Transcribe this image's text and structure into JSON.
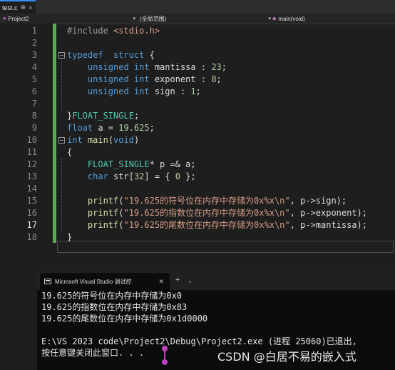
{
  "editor": {
    "tab": {
      "name": "test.c",
      "pin": "⊕",
      "close": "×"
    },
    "nav": {
      "project": "Project2",
      "scope": "(全局范围)",
      "function": "main(void)"
    },
    "line_numbers": [
      "1",
      "2",
      "3",
      "4",
      "5",
      "6",
      "7",
      "8",
      "9",
      "10",
      "11",
      "12",
      "13",
      "14",
      "15",
      "16",
      "17",
      "18"
    ],
    "lines": [
      [
        {
          "t": "#include ",
          "c": "pp"
        },
        {
          "t": "<stdio.h>",
          "c": "str"
        }
      ],
      [],
      [
        {
          "t": "typedef  ",
          "c": "kw"
        },
        {
          "t": "struct ",
          "c": "kw"
        },
        {
          "t": "{",
          "c": "id"
        }
      ],
      [
        {
          "t": "    unsigned ",
          "c": "kw"
        },
        {
          "t": "int ",
          "c": "kw"
        },
        {
          "t": "mantissa : ",
          "c": "id"
        },
        {
          "t": "23",
          "c": "num"
        },
        {
          "t": ";",
          "c": "id"
        }
      ],
      [
        {
          "t": "    unsigned ",
          "c": "kw"
        },
        {
          "t": "int ",
          "c": "kw"
        },
        {
          "t": "exponent : ",
          "c": "id"
        },
        {
          "t": "8",
          "c": "num"
        },
        {
          "t": ";",
          "c": "id"
        }
      ],
      [
        {
          "t": "    unsigned ",
          "c": "kw"
        },
        {
          "t": "int ",
          "c": "kw"
        },
        {
          "t": "sign : ",
          "c": "id"
        },
        {
          "t": "1",
          "c": "num"
        },
        {
          "t": ";",
          "c": "id"
        }
      ],
      [],
      [
        {
          "t": "}",
          "c": "id"
        },
        {
          "t": "FLOAT_SINGLE",
          "c": "ty"
        },
        {
          "t": ";",
          "c": "id"
        }
      ],
      [
        {
          "t": "float ",
          "c": "kw"
        },
        {
          "t": "a = ",
          "c": "id"
        },
        {
          "t": "19.625",
          "c": "num"
        },
        {
          "t": ";",
          "c": "id"
        }
      ],
      [
        {
          "t": "int ",
          "c": "kw"
        },
        {
          "t": "main",
          "c": "fn"
        },
        {
          "t": "(",
          "c": "id"
        },
        {
          "t": "void",
          "c": "kw"
        },
        {
          "t": ")",
          "c": "id"
        }
      ],
      [
        {
          "t": "{",
          "c": "id"
        }
      ],
      [
        {
          "t": "    FLOAT_SINGLE",
          "c": "ty"
        },
        {
          "t": "* p =& a;",
          "c": "id"
        }
      ],
      [
        {
          "t": "    char ",
          "c": "kw"
        },
        {
          "t": "str[",
          "c": "id"
        },
        {
          "t": "32",
          "c": "num"
        },
        {
          "t": "] = { ",
          "c": "id"
        },
        {
          "t": "0",
          "c": "num"
        },
        {
          "t": " };",
          "c": "id"
        }
      ],
      [],
      [
        {
          "t": "    printf",
          "c": "fn"
        },
        {
          "t": "(",
          "c": "id"
        },
        {
          "t": "\"19.625的符号位在内存中存储为0x%x\\n\"",
          "c": "str"
        },
        {
          "t": ", p->sign);",
          "c": "id"
        }
      ],
      [
        {
          "t": "    printf",
          "c": "fn"
        },
        {
          "t": "(",
          "c": "id"
        },
        {
          "t": "\"19.625的指数位在内存中存储为0x%x\\n\"",
          "c": "str"
        },
        {
          "t": ", p->exponent);",
          "c": "id"
        }
      ],
      [
        {
          "t": "    printf",
          "c": "fn"
        },
        {
          "t": "(",
          "c": "id"
        },
        {
          "t": "\"19.625的尾数位在内存中存储为0x%x\\n\"",
          "c": "str"
        },
        {
          "t": ", p->mantissa);",
          "c": "id"
        }
      ],
      [
        {
          "t": "}",
          "c": "id"
        }
      ]
    ],
    "current_line": "17"
  },
  "console": {
    "tab_title": "Microsoft Visual Studio 调试控",
    "plus": "+",
    "output": [
      "19.625的符号位在内存中存储为0x0",
      "19.625的指数位在内存中存储为0x83",
      "19.625的尾数位在内存中存储为0x1d0000",
      "",
      "E:\\VS 2023 code\\Project2\\Debug\\Project2.exe (进程 25060)已退出,",
      "按任意键关闭此窗口. . ."
    ]
  },
  "watermark": "CSDN @白居不易的嵌入式"
}
